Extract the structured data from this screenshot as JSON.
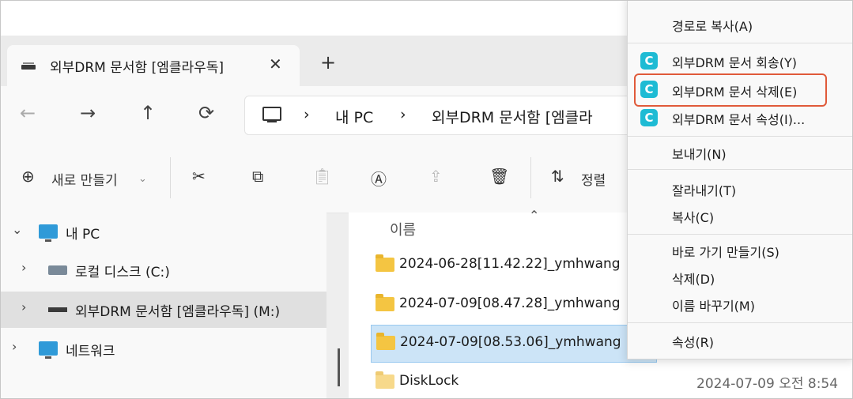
{
  "window": {
    "tab_title": "외부DRM 문서함 [엠클라우독]",
    "tab_close": "✕",
    "new_tab": "+"
  },
  "nav": {
    "back": "←",
    "forward": "→",
    "up": "↑",
    "refresh": "⟳",
    "breadcrumb": [
      "내 PC",
      "외부DRM 문서함 [엠클라"
    ],
    "breadcrumb_sep": "›"
  },
  "commands": {
    "new_label": "새로 만들기",
    "sort_label": "정렬",
    "icons": [
      "cut-icon",
      "copy-icon",
      "paste-icon",
      "rename-icon",
      "share-icon",
      "delete-icon"
    ]
  },
  "tree": [
    {
      "label": "내 PC",
      "expanded": true
    },
    {
      "label": "로컬 디스크 (C:)"
    },
    {
      "label": "외부DRM 문서함 [엠클라우독] (M:)",
      "selected": true
    },
    {
      "label": "네트워크"
    }
  ],
  "files": {
    "column_name": "이름",
    "rows": [
      {
        "name": "2024-06-28[11.42.22]_ymhwang"
      },
      {
        "name": "2024-07-09[08.47.28]_ymhwang"
      },
      {
        "name": "2024-07-09[08.53.06]_ymhwang",
        "selected": true
      },
      {
        "name": "DiskLock"
      }
    ],
    "last_date": "2024-07-09 오전 8:54"
  },
  "context_menu": {
    "copy_path": "경로로 복사(A)",
    "drm_return": "외부DRM 문서 회송(Y)",
    "drm_delete": "외부DRM 문서 삭제(E)",
    "drm_props": "외부DRM 문서 속성(I)...",
    "send_to": "보내기(N)",
    "cut": "잘라내기(T)",
    "copy": "복사(C)",
    "create_shortcut": "바로 가기 만들기(S)",
    "delete": "삭제(D)",
    "rename": "이름 바꾸기(M)",
    "properties": "속성(R)",
    "drm_icon_letter": "C",
    "highlight_color": "#e05a3a"
  }
}
